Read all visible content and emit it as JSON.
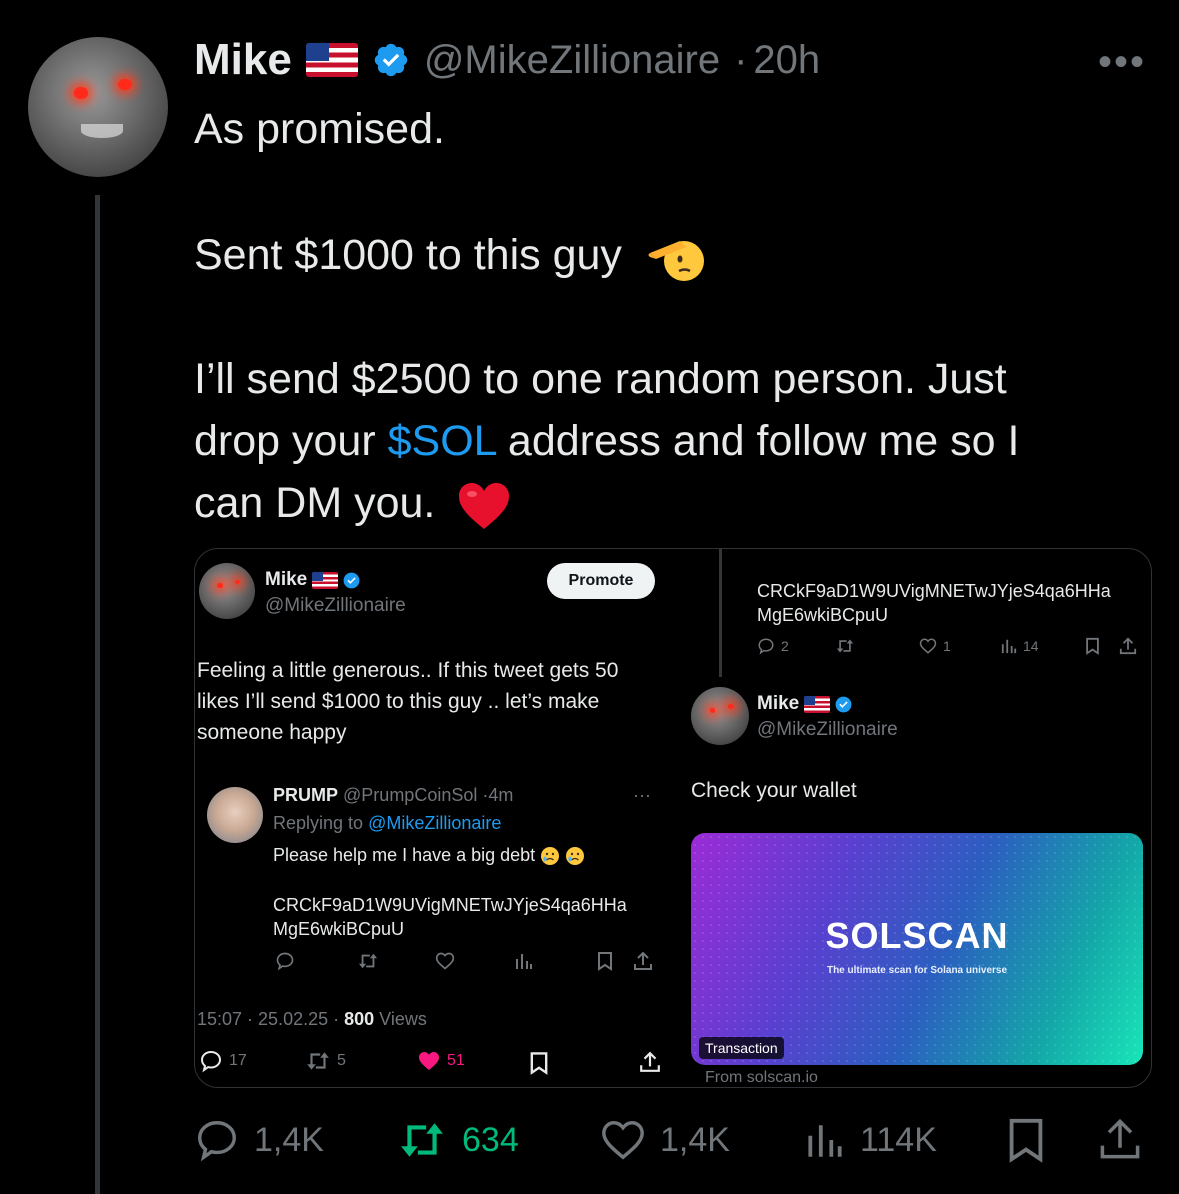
{
  "author": {
    "name": "Mike",
    "handle": "@MikeZillionaire",
    "time": "20h",
    "separator": "·",
    "more": "•••"
  },
  "tweet": {
    "line1": "As promised.",
    "line2": "Sent $1000 to this guy",
    "line3a": "I’ll send $2500 to one random person. Just",
    "line3b_pre": "drop your ",
    "cashtag": "$SOL",
    "line3b_post": " address and follow me so I",
    "line3c": "can DM you."
  },
  "embed": {
    "left": {
      "name": "Mike",
      "handle": "@MikeZillionaire",
      "promote": "Promote",
      "text1": "Feeling a little generous.. If this tweet gets 50",
      "text2": "likes I’ll send $1000 to this guy  .. let’s make",
      "text3": "someone happy",
      "reply": {
        "name": "PRUMP",
        "handle": "@PrumpCoinSol",
        "time": "4m",
        "replying_prefix": "Replying to ",
        "replying_handle": "@MikeZillionaire",
        "text": "Please help me  I have a big debt",
        "addr1": "CRCkF9aD1W9UVigMNETwJYjeS4qa6HHa",
        "addr2": "MgE6wkiBCpuU",
        "more": "···"
      },
      "meta_time": "15:07 · 25.02.25 · ",
      "views_count": "800",
      "views_label": " Views",
      "stats": {
        "replies": "17",
        "reposts": "5",
        "likes": "51"
      }
    },
    "right": {
      "addr1": "CRCkF9aD1W9UVigMNETwJYjeS4qa6HHa",
      "addr2": "MgE6wkiBCpuU",
      "stats": {
        "replies": "2",
        "likes": "1",
        "views": "14"
      },
      "name": "Mike",
      "handle": "@MikeZillionaire",
      "text": "Check your wallet",
      "card": {
        "logo": "SOLSCAN",
        "tagline": "The ultimate scan for Solana universe",
        "badge": "Transaction",
        "source": "From solscan.io"
      }
    }
  },
  "stats": {
    "replies": "1,4K",
    "reposts": "634",
    "likes": "1,4K",
    "views": "114K"
  },
  "colors": {
    "background": "#000000",
    "text": "#e7e9ea",
    "secondary": "#71767b",
    "accent": "#1d9bf0",
    "repost_green": "#00ba7c",
    "like_pink": "#f91880"
  },
  "icons": [
    "verified-badge-icon",
    "us-flag-icon",
    "more-icon",
    "salute-emoji-icon",
    "red-heart-emoji-icon",
    "crying-emoji-icon",
    "reply-icon",
    "repost-icon",
    "like-icon",
    "views-icon",
    "bookmark-icon",
    "share-icon"
  ]
}
